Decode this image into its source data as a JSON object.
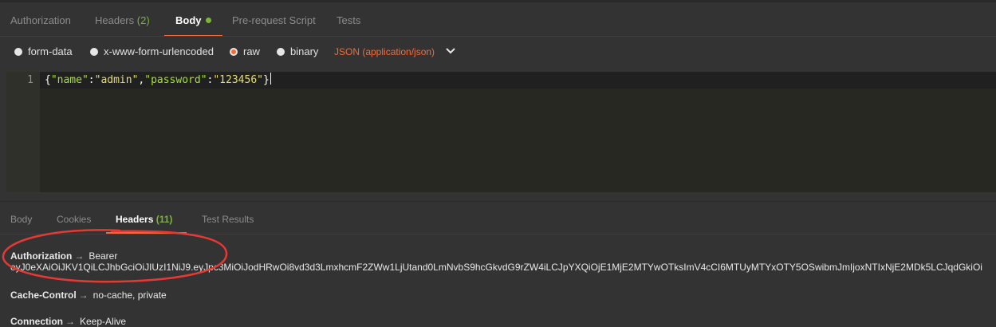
{
  "request_tabs": [
    {
      "label": "Authorization",
      "count": ""
    },
    {
      "label": "Headers",
      "count": "(2)"
    },
    {
      "label": "Body",
      "count": ""
    },
    {
      "label": "Pre-request Script",
      "count": ""
    },
    {
      "label": "Tests",
      "count": ""
    }
  ],
  "body_modes": [
    {
      "label": "form-data",
      "checked": false
    },
    {
      "label": "x-www-form-urlencoded",
      "checked": false
    },
    {
      "label": "raw",
      "checked": true
    },
    {
      "label": "binary",
      "checked": false
    }
  ],
  "content_type": "JSON (application/json)",
  "editor": {
    "line_number": "1",
    "tokens": {
      "brace_open": "{",
      "key1": "\"name\"",
      "colon1": ":",
      "val1": "\"admin\"",
      "comma": ",",
      "key2": "\"password\"",
      "colon2": ":",
      "val2": "\"123456\"",
      "brace_close": "}"
    }
  },
  "response_tabs": [
    {
      "label": "Body",
      "count": ""
    },
    {
      "label": "Cookies",
      "count": ""
    },
    {
      "label": "Headers",
      "count": "(11)"
    },
    {
      "label": "Test Results",
      "count": ""
    }
  ],
  "response_headers": [
    {
      "name": "Authorization",
      "arrow": "→",
      "value": "Bearer",
      "value_line2": "eyJ0eXAiOiJKV1QiLCJhbGciOiJIUzI1NiJ9.eyJpc3MiOiJodHRwOi8vd3d3LmxhcmF2ZWw1LjUtand0LmNvbS9hcGkvdG9rZW4iLCJpYXQiOjE1MjE2MTYwOTksImV4cCI6MTUyMTYxOTY5OSwibmJmIjoxNTIxNjE2MDk5LCJqdGkiOi"
    },
    {
      "name": "Cache-Control",
      "arrow": "→",
      "value": "no-cache, private"
    },
    {
      "name": "Connection",
      "arrow": "→",
      "value": "Keep-Alive"
    }
  ],
  "colors": {
    "accent": "#f26b3a",
    "count_green": "#7cb43c",
    "annotation_red": "#e53935"
  }
}
